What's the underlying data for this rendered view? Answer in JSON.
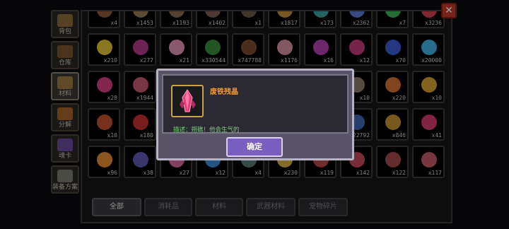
{
  "side_tabs": [
    {
      "label": "背包",
      "icon": "backpack-icon",
      "color": "#8a6a3a",
      "active": false
    },
    {
      "label": "仓库",
      "icon": "chest-icon",
      "color": "#7a5530",
      "active": false
    },
    {
      "label": "材料",
      "icon": "materials-icon",
      "color": "#9a7a45",
      "active": true
    },
    {
      "label": "分解",
      "icon": "decompose-icon",
      "color": "#a0652a",
      "active": false
    },
    {
      "label": "魂卡",
      "icon": "soul-card-icon",
      "color": "#6b4a9a",
      "active": false
    },
    {
      "label": "装备方案",
      "icon": "equipment-plan-icon",
      "color": "#7a7a70",
      "active": false
    }
  ],
  "items": [
    {
      "qty": "x4",
      "icon": "wood-icon",
      "color": "#8a5a3a"
    },
    {
      "qty": "x1453",
      "icon": "ore-icon",
      "color": "#9a7a55"
    },
    {
      "qty": "x1193",
      "icon": "ore-icon",
      "color": "#8a6a50"
    },
    {
      "qty": "x1402",
      "icon": "ore-icon",
      "color": "#7a6050"
    },
    {
      "qty": "x1",
      "icon": "relic-icon",
      "color": "#6a5a4a"
    },
    {
      "qty": "x1817",
      "icon": "shield-icon",
      "color": "#c08a3a"
    },
    {
      "qty": "x173",
      "icon": "gem-icon",
      "color": "#3aa0a0"
    },
    {
      "qty": "x2362",
      "icon": "blocks-icon",
      "color": "#5a7ad0"
    },
    {
      "qty": "x7",
      "icon": "flask-icon",
      "color": "#3ab05a"
    },
    {
      "qty": "x3236",
      "icon": "heart-icon",
      "color": "#d04050"
    },
    {
      "qty": "x210",
      "icon": "smiley-icon",
      "color": "#e0c030"
    },
    {
      "qty": "x277",
      "icon": "demon-icon",
      "color": "#b03a8a"
    },
    {
      "qty": "x21",
      "icon": "paw-icon",
      "color": "#e090b0"
    },
    {
      "qty": "x330544",
      "icon": "orb-icon",
      "color": "#3a8a3a"
    },
    {
      "qty": "x747788",
      "icon": "leather-icon",
      "color": "#7a4a30"
    },
    {
      "qty": "x1176",
      "icon": "hide-icon",
      "color": "#d090a0"
    },
    {
      "qty": "x16",
      "icon": "crystal-icon",
      "color": "#b040b0"
    },
    {
      "qty": "x12",
      "icon": "flower-icon",
      "color": "#c03a7a"
    },
    {
      "qty": "x70",
      "icon": "potion-icon",
      "color": "#3a5ad0"
    },
    {
      "qty": "x20000",
      "icon": "diamond-icon",
      "color": "#40b0e0"
    },
    {
      "qty": "x28",
      "icon": "shard-icon",
      "color": "#d04080"
    },
    {
      "qty": "x1944",
      "icon": "spike-icon",
      "color": "#c05a70"
    },
    {
      "qty": "",
      "icon": "empty-icon",
      "color": "#000000"
    },
    {
      "qty": "",
      "icon": "empty-icon",
      "color": "#000000"
    },
    {
      "qty": "",
      "icon": "empty-icon",
      "color": "#000000"
    },
    {
      "qty": "",
      "icon": "empty-icon",
      "color": "#000000"
    },
    {
      "qty": "",
      "icon": "empty-icon",
      "color": "#000000"
    },
    {
      "qty": "x10",
      "icon": "scroll-icon",
      "color": "#8a7a6a"
    },
    {
      "qty": "x220",
      "icon": "rune-icon",
      "color": "#d07030"
    },
    {
      "qty": "x10",
      "icon": "leaf-icon",
      "color": "#d0a030"
    },
    {
      "qty": "x10",
      "icon": "drum-icon",
      "color": "#c05030"
    },
    {
      "qty": "x180",
      "icon": "glove-icon",
      "color": "#c03030"
    },
    {
      "qty": "",
      "icon": "empty-icon",
      "color": "#000000"
    },
    {
      "qty": "",
      "icon": "empty-icon",
      "color": "#000000"
    },
    {
      "qty": "",
      "icon": "empty-icon",
      "color": "#000000"
    },
    {
      "qty": "",
      "icon": "empty-icon",
      "color": "#000000"
    },
    {
      "qty": "",
      "icon": "empty-icon",
      "color": "#000000"
    },
    {
      "qty": "x22792",
      "icon": "cube-icon",
      "color": "#3a6ab0"
    },
    {
      "qty": "x846",
      "icon": "star-icon",
      "color": "#c09030"
    },
    {
      "qty": "x41",
      "icon": "crystal-icon",
      "color": "#d03a6a"
    },
    {
      "qty": "x96",
      "icon": "flame-icon",
      "color": "#e08a30"
    },
    {
      "qty": "x38",
      "icon": "medal-icon",
      "color": "#5a5ab0"
    },
    {
      "qty": "x27",
      "icon": "petal-icon",
      "color": "#d06a9a"
    },
    {
      "qty": "x12",
      "icon": "ring-icon",
      "color": "#3a8ad0"
    },
    {
      "qty": "x4",
      "icon": "stone-icon",
      "color": "#5a7a7a"
    },
    {
      "qty": "x230",
      "icon": "gold-icon",
      "color": "#d0b040"
    },
    {
      "qty": "x119",
      "icon": "chest-icon",
      "color": "#b04a4a"
    },
    {
      "qty": "x142",
      "icon": "chest-icon",
      "color": "#c04a5a"
    },
    {
      "qty": "x122",
      "icon": "chest-icon",
      "color": "#a04a4a"
    },
    {
      "qty": "x117",
      "icon": "chest-icon",
      "color": "#c05a6a"
    }
  ],
  "filters": [
    {
      "label": "全部",
      "active": true
    },
    {
      "label": "消耗品",
      "active": false
    },
    {
      "label": "材料",
      "active": false
    },
    {
      "label": "武器材料",
      "active": false
    },
    {
      "label": "宠物碎片",
      "active": false
    }
  ],
  "close_label": "✕",
  "dialog": {
    "title": "废铁残晶",
    "description": "描述：朔礁！他会生气的",
    "confirm_label": "确定",
    "item_icon": "crystal-shard-icon",
    "item_color": "#e0407a"
  }
}
